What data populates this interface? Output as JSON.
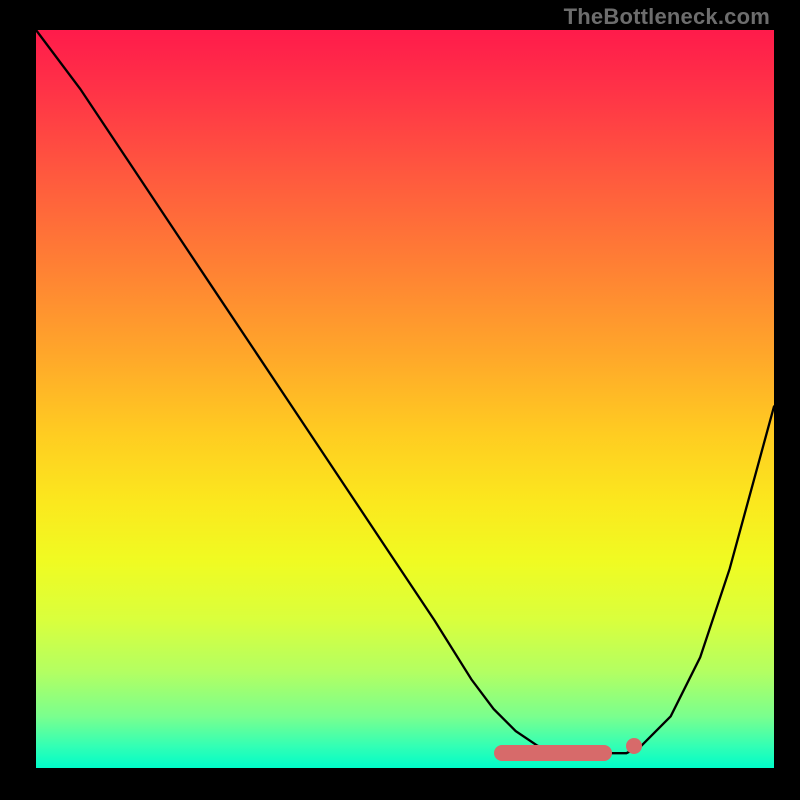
{
  "watermark": "TheBottleneck.com",
  "chart_data": {
    "type": "line",
    "title": "",
    "xlabel": "",
    "ylabel": "",
    "xlim": [
      0,
      100
    ],
    "ylim": [
      0,
      100
    ],
    "grid": false,
    "legend": false,
    "series": [
      {
        "name": "bottleneck-curve",
        "x": [
          0,
          6,
          12,
          18,
          24,
          30,
          36,
          42,
          48,
          54,
          59,
          62,
          65,
          68,
          71,
          74,
          77,
          80,
          82,
          86,
          90,
          94,
          100
        ],
        "values": [
          100,
          92,
          83,
          74,
          65,
          56,
          47,
          38,
          29,
          20,
          12,
          8,
          5,
          3,
          2,
          2,
          2,
          2,
          3,
          7,
          15,
          27,
          49
        ]
      }
    ],
    "markers": [
      {
        "name": "sweet-spot-bar",
        "shape": "capsule",
        "x_start": 62,
        "x_end": 78,
        "y": 2
      },
      {
        "name": "dot",
        "shape": "circle",
        "x": 81,
        "y": 3
      }
    ],
    "gradient_stops": [
      {
        "pct": 0,
        "color": "#ff1b4b"
      },
      {
        "pct": 50,
        "color": "#ffc024"
      },
      {
        "pct": 100,
        "color": "#00fcc9"
      }
    ]
  }
}
